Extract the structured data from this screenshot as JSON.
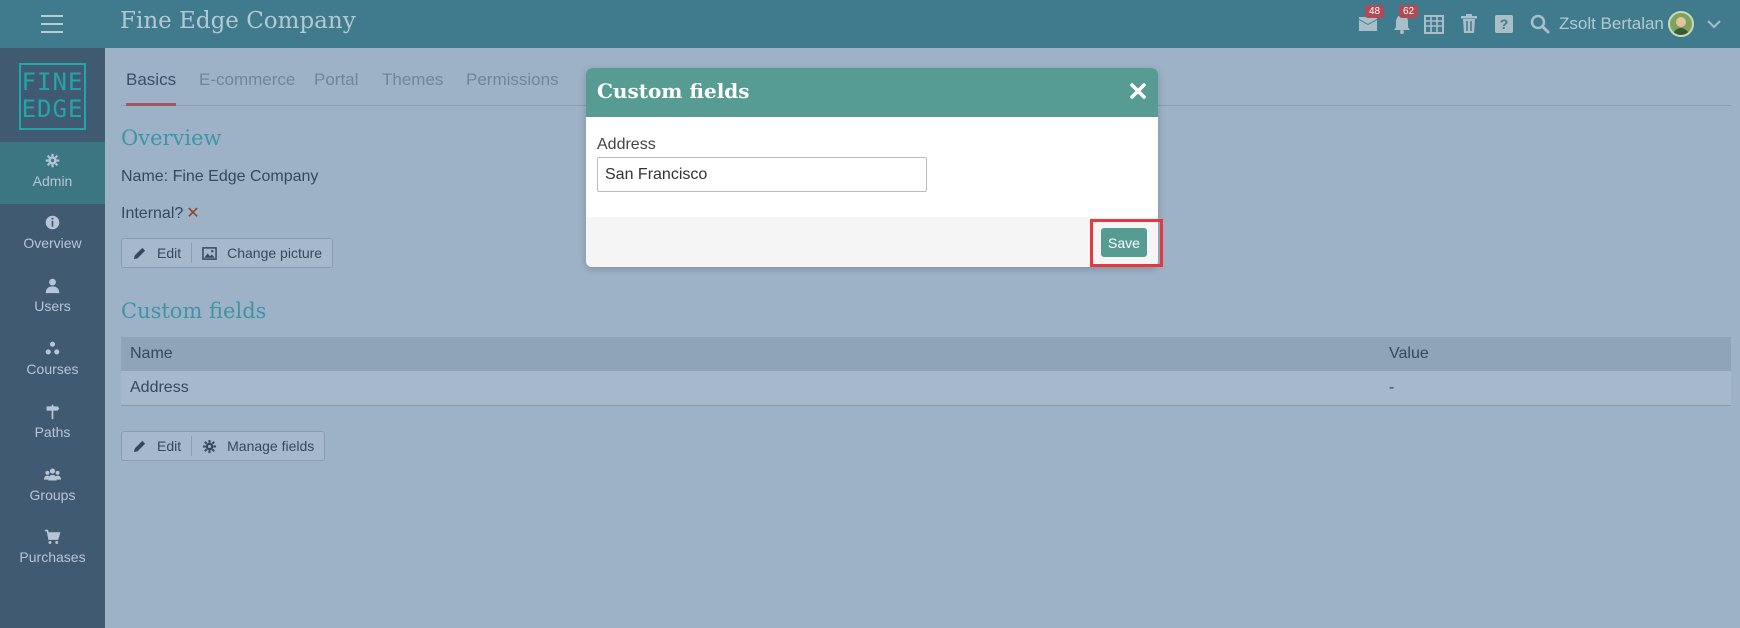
{
  "header": {
    "company_name": "Fine Edge Company",
    "notifications": [
      {
        "icon": "messages-icon",
        "count": "48"
      },
      {
        "icon": "bell-icon",
        "count": "62"
      }
    ],
    "user_name": "Zsolt Bertalan"
  },
  "logo": {
    "line1": "FINE",
    "line2": "EDGE"
  },
  "sidebar": {
    "items": [
      {
        "label": "Admin",
        "icon": "gear-icon",
        "active": true
      },
      {
        "label": "Overview",
        "icon": "info-icon"
      },
      {
        "label": "Users",
        "icon": "user-icon"
      },
      {
        "label": "Courses",
        "icon": "courses-icon"
      },
      {
        "label": "Paths",
        "icon": "signpost-icon"
      },
      {
        "label": "Groups",
        "icon": "group-icon"
      },
      {
        "label": "Purchases",
        "icon": "cart-icon"
      }
    ]
  },
  "tabs": [
    "Basics",
    "E-commerce",
    "Portal",
    "Themes",
    "Permissions"
  ],
  "overview": {
    "title": "Overview",
    "name_line": "Name: Fine Edge Company",
    "internal_label": "Internal?",
    "internal_value": "✕",
    "edit_label": "Edit",
    "change_picture_label": "Change picture"
  },
  "custom_fields": {
    "title": "Custom fields",
    "columns": [
      "Name",
      "Value"
    ],
    "rows": [
      {
        "name": "Address",
        "value": "-"
      }
    ],
    "edit_label": "Edit",
    "manage_label": "Manage fields"
  },
  "modal": {
    "title": "Custom fields",
    "field_label": "Address",
    "field_value": "San Francisco",
    "save_label": "Save"
  },
  "colors": {
    "topbar": "#3f7b8c",
    "sidebar": "#405a72",
    "accent": "#579c92",
    "highlight": "#e5393f"
  }
}
